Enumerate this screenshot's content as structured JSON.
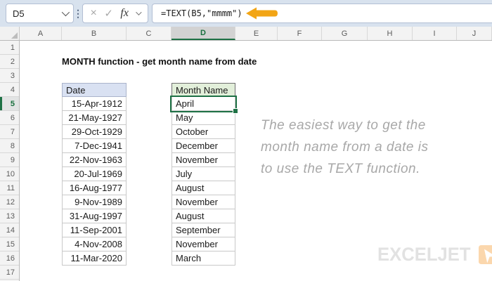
{
  "formula_bar": {
    "name_box_value": "D5",
    "cancel_label": "×",
    "confirm_label": "✓",
    "fx_label": "fx",
    "formula": "=TEXT(B5,\"mmmm\")"
  },
  "sheet": {
    "column_headers": [
      "A",
      "B",
      "C",
      "D",
      "E",
      "F",
      "G",
      "H",
      "I",
      "J"
    ],
    "selected_column": "D",
    "row_headers": [
      "1",
      "2",
      "3",
      "4",
      "5",
      "6",
      "7",
      "8",
      "9",
      "10",
      "11",
      "12",
      "13",
      "14",
      "15",
      "16",
      "17"
    ],
    "selected_row": "5",
    "selected_cell": "D5"
  },
  "content": {
    "title": "MONTH function - get month name from date",
    "table": {
      "headers": {
        "date": "Date",
        "month": "Month Name"
      },
      "rows": [
        {
          "date": "15-Apr-1912",
          "month": "April"
        },
        {
          "date": "21-May-1927",
          "month": "May"
        },
        {
          "date": "29-Oct-1929",
          "month": "October"
        },
        {
          "date": "7-Dec-1941",
          "month": "December"
        },
        {
          "date": "22-Nov-1963",
          "month": "November"
        },
        {
          "date": "20-Jul-1969",
          "month": "July"
        },
        {
          "date": "16-Aug-1977",
          "month": "August"
        },
        {
          "date": "9-Nov-1989",
          "month": "November"
        },
        {
          "date": "31-Aug-1997",
          "month": "August"
        },
        {
          "date": "11-Sep-2001",
          "month": "September"
        },
        {
          "date": "4-Nov-2008",
          "month": "November"
        },
        {
          "date": "11-Mar-2020",
          "month": "March"
        }
      ]
    },
    "note_lines": [
      "The easiest way to get the",
      "month name from a date is",
      "to use the TEXT function."
    ],
    "logo_text": "EXCELJET"
  },
  "colors": {
    "selection_green": "#1E7145",
    "arrow_orange": "#F2A516",
    "date_header_fill": "#D9E1F2",
    "month_header_fill": "#E2EFDA",
    "logo_icon_fill": "#FBD7AD",
    "formula_bar_bg": "#D8E2EE"
  }
}
